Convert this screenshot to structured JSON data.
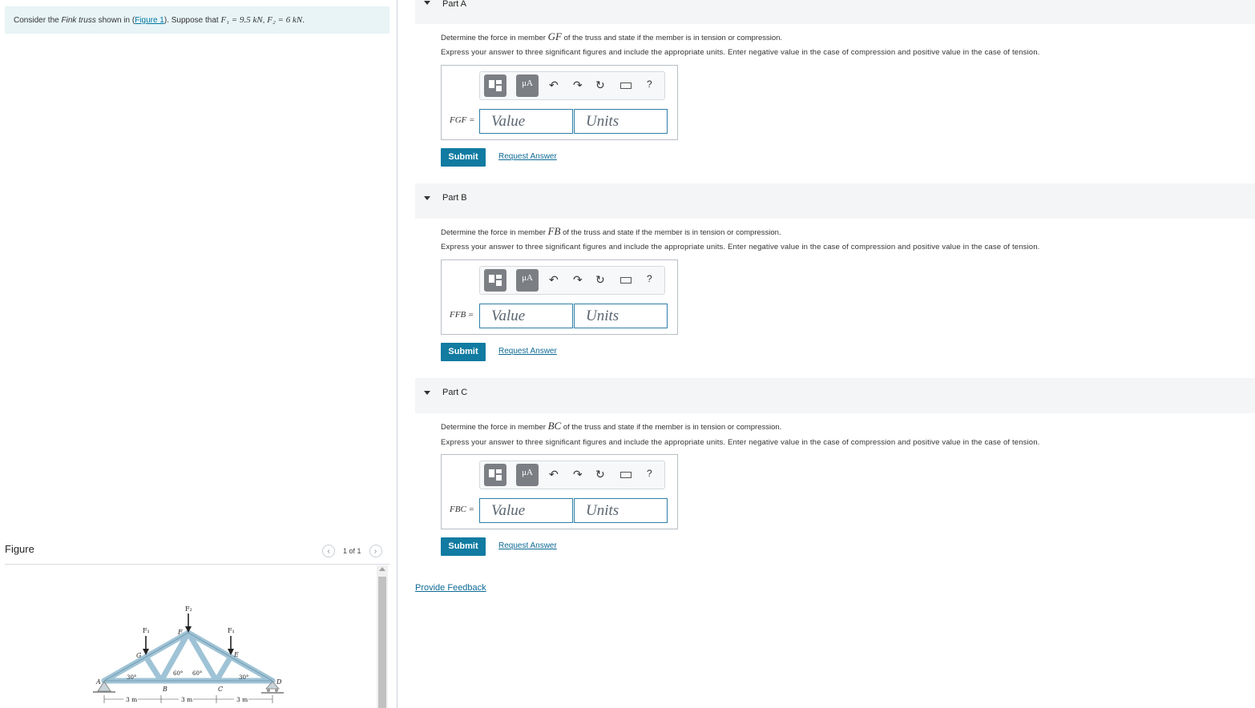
{
  "problem": {
    "prefix": "Consider the ",
    "truss_name": "Fink truss",
    "mid": " shown in (",
    "figure_link": "Figure 1",
    "suffix": "). Suppose that ",
    "f1": "F₁ = 9.5 kN",
    "sep": ", ",
    "f2": "F₂ = 6 kN",
    "end": "."
  },
  "figure": {
    "title": "Figure",
    "pager": "1 of 1",
    "labels": {
      "F2": "F₂",
      "F1a": "F₁",
      "F1b": "F₁",
      "A": "A",
      "B": "B",
      "C": "C",
      "D": "D",
      "E": "E",
      "F": "F",
      "G": "G",
      "ang1": "30°",
      "ang2": "60°",
      "ang3": "60°",
      "ang4": "30°",
      "dim1": "3 m",
      "dim2": "3 m",
      "dim3": "3 m"
    }
  },
  "parts": [
    {
      "label": "Part A",
      "question_pre": "Determine the force in member ",
      "member": "GF",
      "question_post": " of the truss and state if the member is in tension or compression.",
      "instructions": "Express your answer to three significant figures and include the appropriate units. Enter negative value in the case of compression and positive value in the case of tension.",
      "field_label": "FGF =",
      "value_placeholder": "Value",
      "units_placeholder": "Units",
      "mu_label": "μA",
      "help": "?",
      "submit": "Submit",
      "request": "Request Answer"
    },
    {
      "label": "Part B",
      "question_pre": "Determine the force in member ",
      "member": "FB",
      "question_post": " of the truss and state if the member is in tension or compression.",
      "instructions": "Express your answer to three significant figures and include the appropriate units. Enter negative value in the case of compression and positive value in the case of tension.",
      "field_label": "FFB =",
      "value_placeholder": "Value",
      "units_placeholder": "Units",
      "mu_label": "μA",
      "help": "?",
      "submit": "Submit",
      "request": "Request Answer"
    },
    {
      "label": "Part C",
      "question_pre": "Determine the force in member ",
      "member": "BC",
      "question_post": " of the truss and state if the member is in tension or compression.",
      "instructions": "Express your answer to three significant figures and include the appropriate units. Enter negative value in the case of compression and positive value in the case of tension.",
      "field_label": "FBC =",
      "value_placeholder": "Value",
      "units_placeholder": "Units",
      "mu_label": "μA",
      "help": "?",
      "submit": "Submit",
      "request": "Request Answer"
    }
  ],
  "feedback": "Provide Feedback",
  "icons": {
    "undo": "undo-icon",
    "redo": "redo-icon",
    "reset": "reset-icon",
    "keyboard": "keyboard-icon",
    "templates": "templates-icon"
  },
  "colors": {
    "accent": "#117ba1",
    "link": "#0e6a95",
    "problem_bg": "#e8f4f6",
    "truss": "#9fc3d6"
  }
}
